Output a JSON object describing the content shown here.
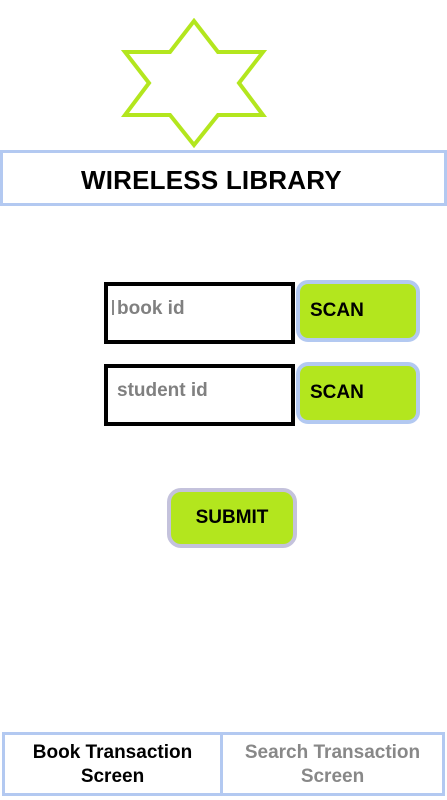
{
  "app": {
    "title": "WIRELESS LIBRARY",
    "logo_icon": "star-of-david-icon",
    "accent_color": "#b3e61e",
    "border_color": "#b3c9f1"
  },
  "form": {
    "book_id": {
      "placeholder": "book id",
      "value": ""
    },
    "student_id": {
      "placeholder": "student id",
      "value": ""
    },
    "scan_book_label": "SCAN",
    "scan_student_label": "SCAN",
    "submit_label": "SUBMIT"
  },
  "nav": {
    "tabs": [
      {
        "label": "Book Transaction Screen",
        "active": true
      },
      {
        "label": "Search Transaction Screen",
        "active": false
      }
    ]
  }
}
